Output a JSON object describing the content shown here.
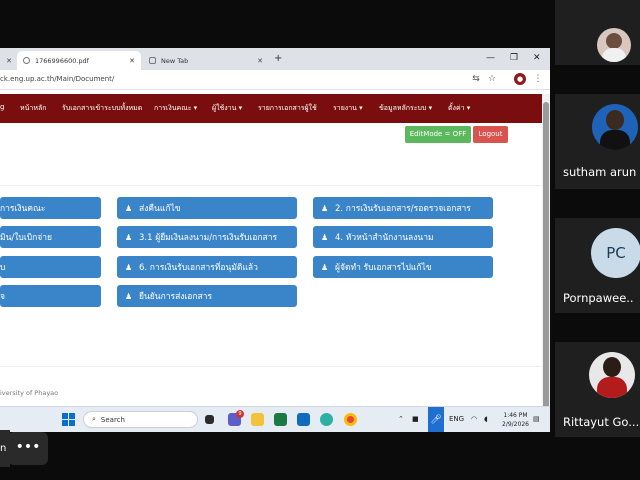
{
  "browser": {
    "tabs": [
      {
        "label": "1766996600.pdf"
      },
      {
        "label": "New Tab"
      }
    ],
    "new_tab_label": "+",
    "url": "ck.eng.up.ac.th/Main/Document/"
  },
  "site": {
    "nav": [
      "g",
      "หน้าหลัก",
      "รับเอกสารเข้าระบบทั้งหมด",
      "การเงินคณะ ▾",
      "ผู้ใช้งาน ▾",
      "รายการเอกสารผู้ใช้",
      "รายงาน ▾",
      "ข้อมูลหลักระบบ ▾",
      "ตั้งค่า ▾"
    ],
    "editmode": "EditMode = OFF",
    "logout": "Logout",
    "buttons": [
      {
        "label": "การเงินคณะ",
        "icon": "person-icon"
      },
      {
        "label": "มิน/ใบเบิกจ่าย",
        "icon": "person-icon"
      },
      {
        "label": "บ",
        "icon": "person-icon"
      },
      {
        "label": "จ",
        "icon": "person-icon"
      },
      {
        "label": "ส่งคืนแก้ไข",
        "icon": "person-icon"
      },
      {
        "label": "3.1 ผู้ยืมเงินลงนาม/การเงินรับเอกสาร",
        "icon": "person-icon"
      },
      {
        "label": "6. การเงินรับเอกสารที่อนุมัติแล้ว",
        "icon": "person-icon"
      },
      {
        "label": "ยืนยันการส่งเอกสาร",
        "icon": "person-icon"
      },
      {
        "label": "2. การเงินรับเอกสาร/รอตรวจเอกสาร",
        "icon": "person-icon"
      },
      {
        "label": "4. หัวหน้าสำนักงานลงนาม",
        "icon": "person-icon"
      },
      {
        "label": "ผู้จัดทำ รับเอกสารไปแก้ไข",
        "icon": "person-icon"
      }
    ],
    "footer": "iversity of Phayao"
  },
  "taskbar": {
    "search": "Search",
    "lang": "ENG",
    "time": "1:46 PM",
    "date": "2/9/2026",
    "badge": "9"
  },
  "meeting": {
    "participants": [
      {
        "name": ""
      },
      {
        "name": "sutham arun"
      },
      {
        "name": "Pornpawee..",
        "initials": "PC"
      },
      {
        "name": "Rittayut Go..."
      }
    ],
    "left_label": "n",
    "more": "•••"
  },
  "colors": {
    "nav_bg": "#7a0e0e",
    "button_blue": "#3a85c9",
    "edit_green": "#5cb85c",
    "logout_red": "#d9534f"
  }
}
